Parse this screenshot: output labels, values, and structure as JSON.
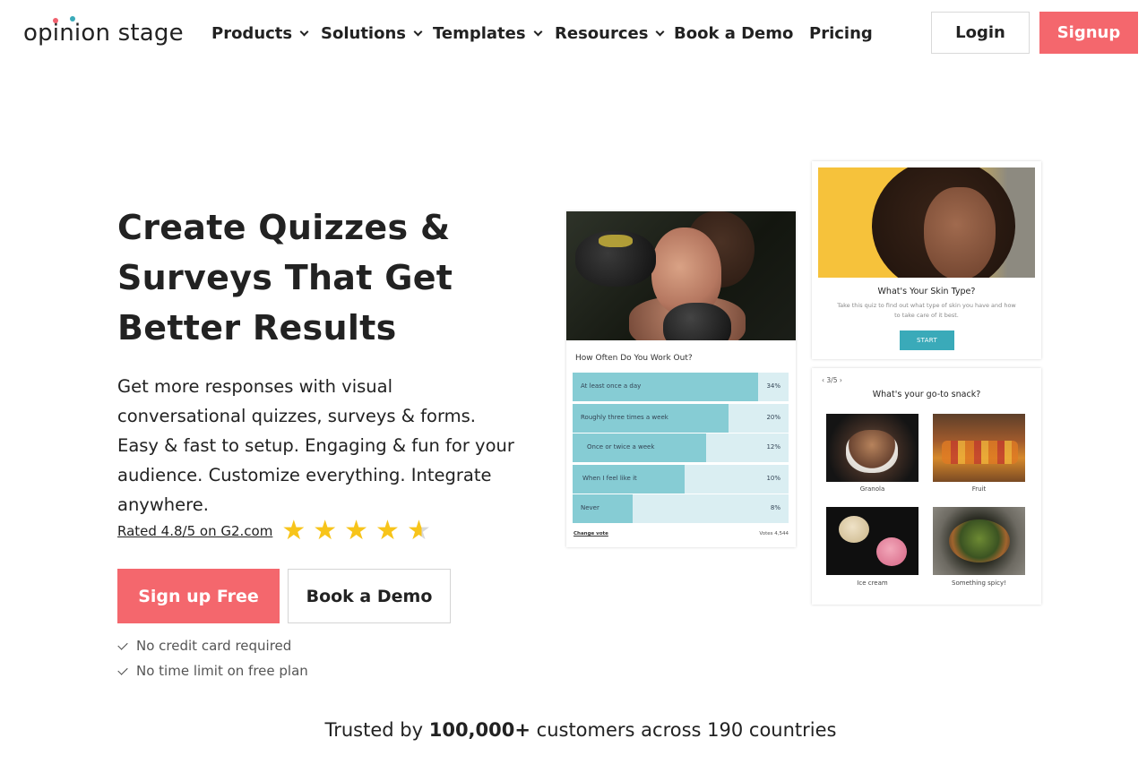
{
  "brand": {
    "logo_text": "opinion stage",
    "accent": "#f4676d",
    "teal": "#3aaab9"
  },
  "nav": {
    "items": [
      {
        "label": "Products",
        "dropdown": true
      },
      {
        "label": "Solutions",
        "dropdown": true
      },
      {
        "label": "Templates",
        "dropdown": true
      },
      {
        "label": "Resources",
        "dropdown": true
      },
      {
        "label": "Book a Demo",
        "dropdown": false
      },
      {
        "label": "Pricing",
        "dropdown": false
      }
    ],
    "login": "Login",
    "signup": "Signup"
  },
  "hero": {
    "title": "Create Quizzes & Surveys That Get Better Results",
    "description": "Get more responses with visual conversational quizzes, surveys & forms. Easy & fast to setup. Engaging & fun for your audience. Customize everything. Integrate anywhere.",
    "rating_text": "Rated 4.8/5 on G2.com",
    "rating_value": 4.8,
    "rating_max": 5,
    "cta_primary": "Sign up Free",
    "cta_secondary": "Book a Demo",
    "perks": [
      "No credit card required",
      "No time limit on free plan"
    ]
  },
  "trusted": {
    "prefix": "Trusted by",
    "count": "100,000+",
    "suffix": "customers across 190 countries"
  },
  "poll": {
    "question": "How Often Do You Work Out?",
    "options": [
      {
        "label": "At least once a day",
        "pct_label": "34%",
        "fill": 0.86
      },
      {
        "label": "Roughly three times a week",
        "pct_label": "20%",
        "fill": 0.72
      },
      {
        "label": "Once or twice a week",
        "pct_label": "12%",
        "fill": 0.62
      },
      {
        "label": "When I feel like it",
        "pct_label": "10%",
        "fill": 0.52
      },
      {
        "label": "Never",
        "pct_label": "8%",
        "fill": 0.28
      }
    ],
    "change_vote": "Change vote",
    "votes": "Votes 4,544"
  },
  "skin_quiz": {
    "title": "What's Your Skin Type?",
    "subtitle": "Take this quiz to find out what type of skin you have and how to take care of it best.",
    "start": "START"
  },
  "snack_quiz": {
    "pager": "3/5",
    "question": "What's your go-to snack?",
    "options": [
      {
        "caption": "Granola"
      },
      {
        "caption": "Fruit"
      },
      {
        "caption": "Ice cream"
      },
      {
        "caption": "Something spicy!"
      }
    ]
  }
}
